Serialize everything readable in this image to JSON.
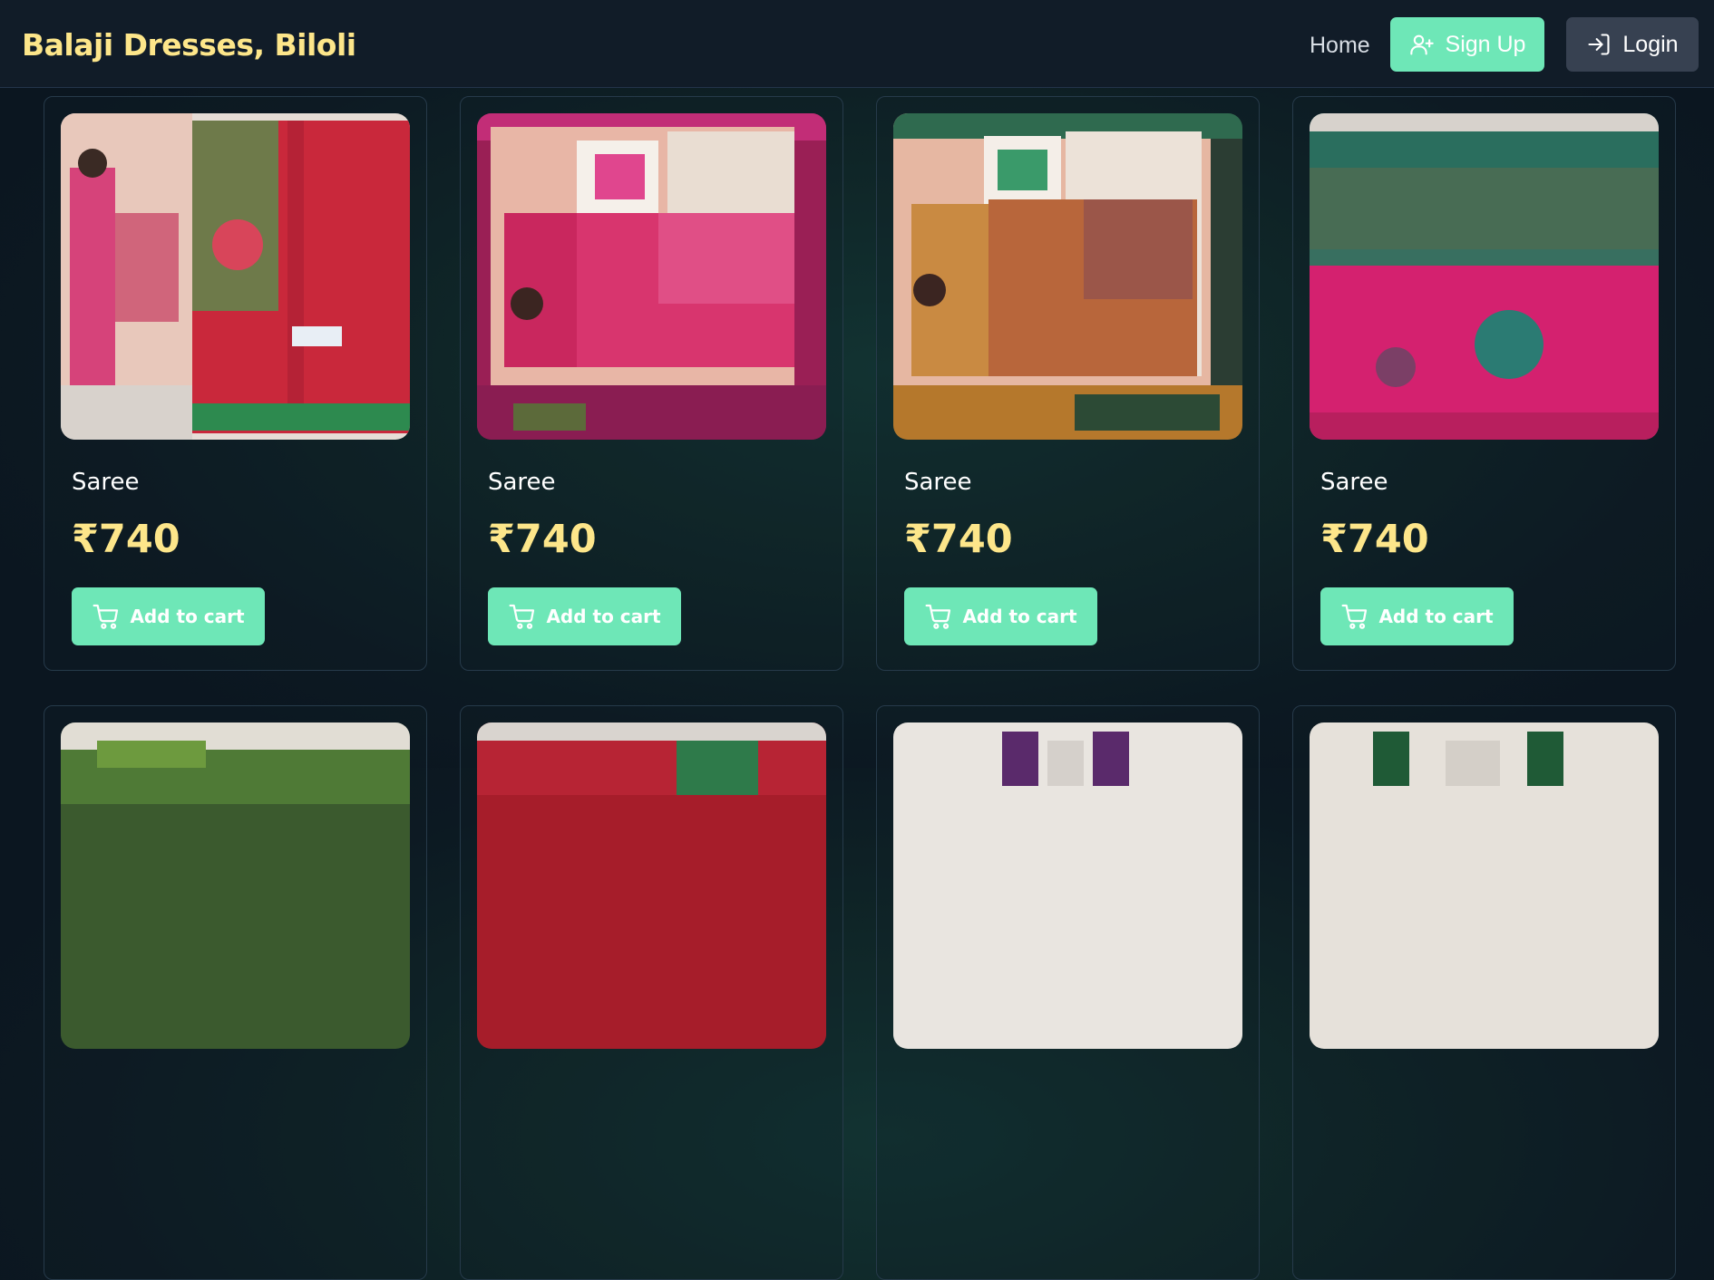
{
  "header": {
    "brand": "Balaji Dresses, Biloli",
    "nav": {
      "home": "Home",
      "signup": "Sign Up",
      "login": "Login"
    }
  },
  "products": [
    {
      "name": "Saree",
      "price": "₹740",
      "cart_label": "Add to cart",
      "image_desc": "pink and green silk saree with packaging"
    },
    {
      "name": "Saree",
      "price": "₹740",
      "cart_label": "Add to cart",
      "image_desc": "pink kashmiri silk saree in packaging"
    },
    {
      "name": "Saree",
      "price": "₹740",
      "cart_label": "Add to cart",
      "image_desc": "orange kashmiri silk saree in packaging"
    },
    {
      "name": "Saree",
      "price": "₹740",
      "cart_label": "Add to cart",
      "image_desc": "pink and teal saree fabric"
    },
    {
      "name": "",
      "price": "",
      "cart_label": "",
      "image_desc": "green saree fabric"
    },
    {
      "name": "",
      "price": "",
      "cart_label": "",
      "image_desc": "red and green saree fabric"
    },
    {
      "name": "",
      "price": "",
      "cart_label": "",
      "image_desc": "purple saree packaging"
    },
    {
      "name": "",
      "price": "",
      "cart_label": "",
      "image_desc": "green saree packaging"
    }
  ],
  "colors": {
    "accent": "#6ee7b7",
    "brand": "#fde68a",
    "price": "#fde68a",
    "navbar": "#111c28",
    "login_button": "#374151"
  },
  "icons": {
    "signup": "user-plus-icon",
    "login": "login-icon",
    "cart": "cart-icon"
  }
}
